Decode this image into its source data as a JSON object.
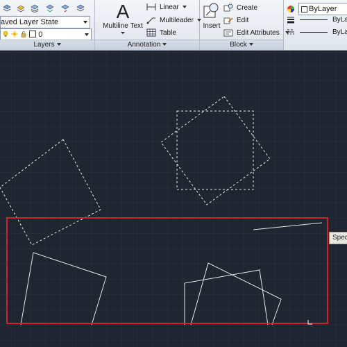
{
  "layers": {
    "state_combo": "aved Layer State",
    "layer_combo": "0",
    "panel_title": "Layers"
  },
  "annotation": {
    "multiline_text_glyph": "A",
    "multiline_text_label": "Multiline Text",
    "linear_label": "Linear",
    "multileader_label": "Multileader",
    "table_label": "Table",
    "panel_title": "Annotation"
  },
  "block": {
    "insert_label": "Insert",
    "create_label": "Create",
    "edit_label": "Edit",
    "edit_attributes_label": "Edit Attributes",
    "panel_title": "Block"
  },
  "properties": {
    "color_value": "ByLayer",
    "lineweight_value": "ByLaye",
    "linetype_value": "ByLaye"
  },
  "canvas": {
    "tooltip": "Specify"
  },
  "colors": {
    "canvas_bg": "#1f2631",
    "grid": "#2b3340",
    "selection_box": "#d4202a",
    "geometry": "#e8e8e8"
  }
}
